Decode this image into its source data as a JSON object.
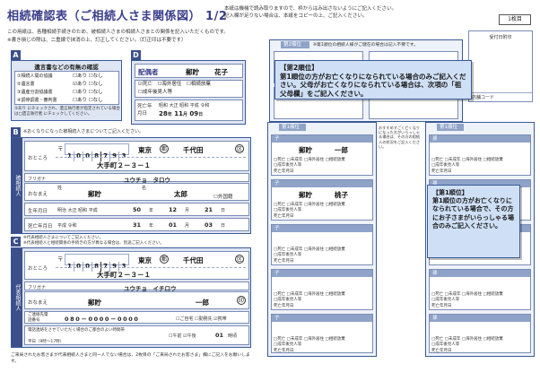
{
  "header": {
    "title": "相続確認表（ご相続人さま関係図） 1/2",
    "note_top_1": "本紙は機械で読み取りますので、枠からはみ出さないようにご記入ください。",
    "note_top_2": "記入欄が足りない場合は、本紙をコピーの上、ご記入ください。",
    "page_count": "1枚目",
    "intro_1": "この用紙は、各種相続手続きのため、被相続人さまの相続人さまとの関係を記入いただくものです。",
    "intro_2": "※書き損じの際は、二重線で抹消の上、訂正してください。（訂正印は不要です）"
  },
  "receipt": {
    "label": "受付日附印",
    "store_code": "店舗コード"
  },
  "section_a": {
    "letter": "A",
    "title": "遺言書などの有無の確認",
    "rows": [
      {
        "label": "①相続人間の協議",
        "yes": "あり",
        "no": "なし"
      },
      {
        "label": "②遺言書",
        "yes": "あり",
        "no": "なし"
      },
      {
        "label": "③遺産分割協議書",
        "yes": "あり",
        "no": "なし"
      },
      {
        "label": "④調停調書・審判書",
        "yes": "あり",
        "no": "なし"
      }
    ],
    "note": "②あり にチェックされ、遺言執行者が指定されている場合は□遺言執行者 にチェックしてください。"
  },
  "section_b": {
    "letter": "B",
    "note": "※おくなりになった被相続人さまについてご記入ください。",
    "side_label": "被相続人",
    "postal_mark": "〒",
    "postal": [
      "1",
      "0",
      "0",
      "8",
      "7",
      "9",
      "3"
    ],
    "pref": "東京",
    "pref_suffix": "都",
    "city": "千代田",
    "city_suffix": "区",
    "address_label": "おところ",
    "address": "大手町２－３－１",
    "kana_label": "フリガナ",
    "kana": "ユウチョ　タロウ",
    "name_label": "おなまえ",
    "surname_label": "姓",
    "given_label": "名",
    "surname": "郵貯",
    "given": "太郎",
    "foreigner": "外国籍",
    "birth_label": "生年月日",
    "birth_eras": "明治 大正 昭和 平成",
    "birth_year": "50",
    "birth_month": "12",
    "birth_day": "21",
    "death_label": "死亡年月日",
    "death_eras": "平成 令和",
    "death_year": "31",
    "death_month": "01",
    "death_day": "03",
    "unit_year": "年",
    "unit_month": "月",
    "unit_day": "日"
  },
  "section_c": {
    "letter": "C",
    "note_1": "※代表相続人さまについてご記入ください。",
    "note_2": "※代表相続人と相続関係の手続きの方が異なる場合は、別途ご記入ください。",
    "side_label": "代表相続人",
    "postal_mark": "〒",
    "postal": [
      "1",
      "0",
      "0",
      "8",
      "7",
      "9",
      "3"
    ],
    "pref": "東京",
    "pref_suffix": "都",
    "city": "千代田",
    "city_suffix": "区",
    "address_label": "おところ",
    "address": "大手町２－３－１",
    "kana_label": "フリガナ",
    "kana": "ユウチョ　イチロウ",
    "name_label": "おなまえ",
    "surname": "郵貯",
    "given": "一郎",
    "phone_label": "ご連絡先電話番号",
    "phone": "080－0000－0000",
    "phone_types": [
      "ご自宅",
      "勤務先",
      "携帯"
    ],
    "time_note": "電話連絡をさせていただく場合のご都合のよい時間帯",
    "time_ampm": [
      "午前",
      "午後"
    ],
    "time_value": "01",
    "time_unit": "時頃",
    "time_foot": "平日（9時〜17時）",
    "foot": "ご来局されたお客さまが代表相続人さまと同一人でない場合は、2枚目の「ご来局されたお客さま」欄にご記入をお願いします。"
  },
  "section_d": {
    "letter": "D",
    "title": "配偶者",
    "surname": "郵貯",
    "given": "花子",
    "options": [
      "死亡",
      "海外居住",
      "相続放棄",
      "成年後見人等"
    ],
    "death_label": "死亡年月日",
    "eras": "昭和 大正 昭和 平成 令和",
    "year": "28",
    "month": "11",
    "day": "09"
  },
  "section_g": {
    "letter": "G",
    "title": "第2順位",
    "note": "※第1順位の相続人様がご健在の場合は記入不要です。",
    "callout_1": "【第2順位】",
    "callout_2": "第1順位の方がお亡くなりになられている場合のみご記入ください。父母がお亡くなりになられている場合は、次項の「祖父母欄」をご記入ください。"
  },
  "section_e": {
    "letter": "E",
    "rank_label": "第1順位",
    "child_label": "子",
    "children": [
      {
        "surname": "郵貯",
        "given": "一郎"
      },
      {
        "surname": "郵貯",
        "given": "桃子"
      },
      {
        "surname": "",
        "given": ""
      },
      {
        "surname": "",
        "given": ""
      },
      {
        "surname": "",
        "given": ""
      }
    ],
    "options": "□死亡 □未成年 □海外居住 □相続放棄",
    "options_2": "□成年後見人等",
    "death_label": "死亡年月日",
    "side_note": "おすすめすごく亡くなりになった方がいらっしゃる場合は、その方の相続人の状況をご記入ください。"
  },
  "section_f": {
    "letter": "F",
    "rank_label": "第1順位",
    "grand_label": "孫",
    "callout_1": "【第1順位】",
    "callout_2": "第1順位の方がお亡くなりになられている場合で、その方にお子さまがいらっしゃる場合のみご記入ください。",
    "options": "□死亡 □未成年 □海外居住 □相続放棄",
    "options_2": "□成年後見人等",
    "death_label": "死亡年月日"
  },
  "colors": {
    "navy": "#3b4f8a",
    "panel": "#dfe6f3",
    "callout": "#cfe0f6"
  }
}
